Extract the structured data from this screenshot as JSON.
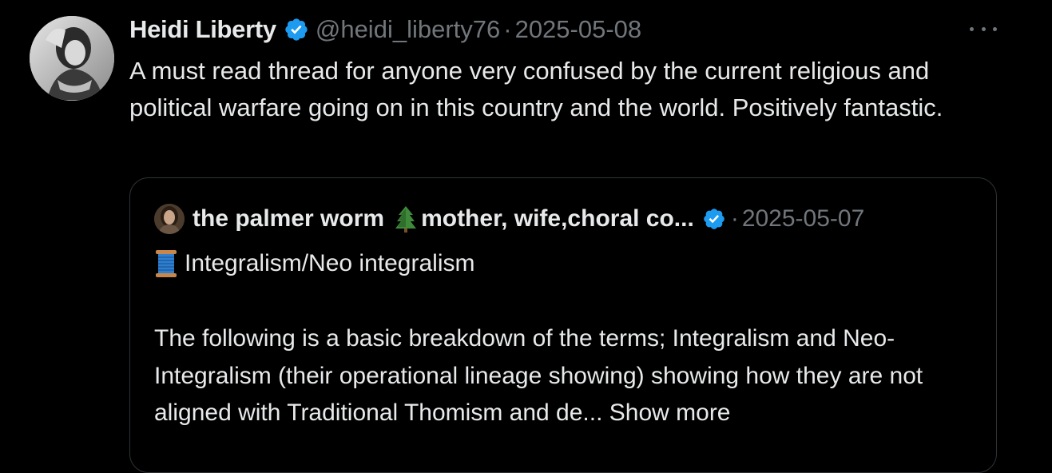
{
  "tweet": {
    "author": {
      "display_name": "Heidi Liberty",
      "handle": "@heidi_liberty76",
      "verified": true
    },
    "separator": "·",
    "date": "2025-05-08",
    "text": "A must read thread for anyone very confused by the current religious and political warfare going on in this country and the world. Positively fantastic.",
    "more_icon": "more-horizontal-icon"
  },
  "quoted_tweet": {
    "author": {
      "display_name": "the palmer worm",
      "name_emoji": "evergreen-tree-icon",
      "display_name_rest": "mother, wife,choral co...",
      "verified": true
    },
    "separator": "·",
    "date": "2025-05-07",
    "first_line_emoji": "spool-of-thread-icon",
    "first_line": "Integralism/Neo integralism",
    "body": "The following is a basic breakdown of the terms; Integralism and Neo-Integralism (their operational lineage showing) showing how they are not aligned with Traditional Thomism and de...",
    "show_more_label": "Show more"
  },
  "colors": {
    "background": "#000000",
    "text_primary": "#e7e9ea",
    "text_secondary": "#71767b",
    "verified_badge": "#1d9bf0",
    "border": "#2f3336"
  }
}
